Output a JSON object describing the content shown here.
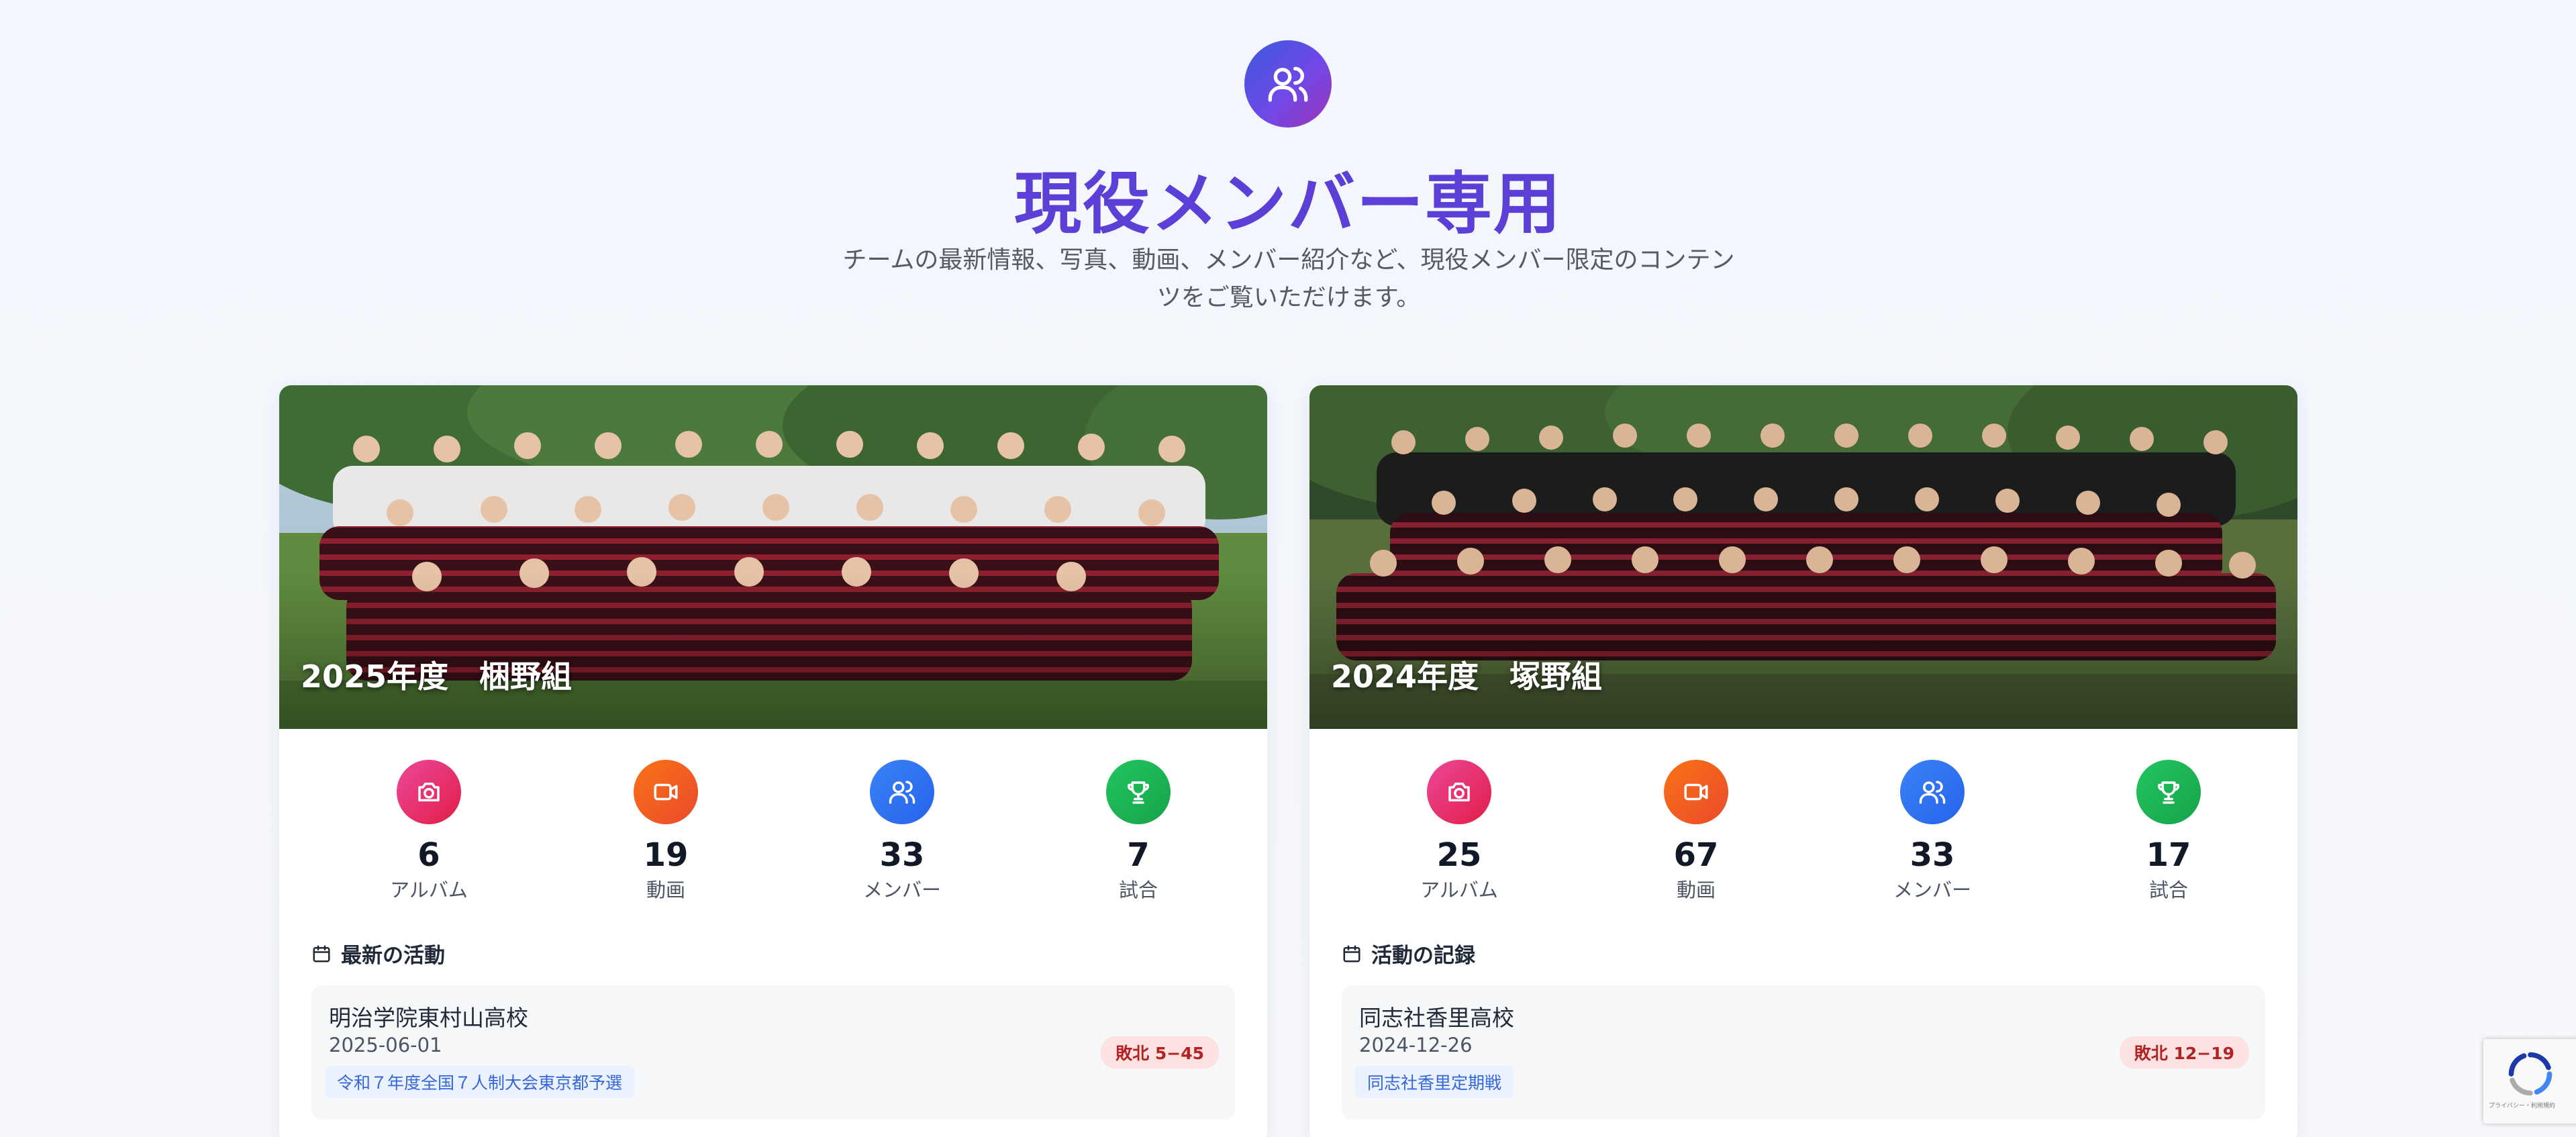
{
  "header": {
    "icon": "users-icon",
    "title": "現役メンバー専用",
    "description": "チームの最新情報、写真、動画、メンバー紹介など、現役メンバー限定のコンテンツをご覧いただけます。"
  },
  "cards": [
    {
      "title": "2025年度　梱野組",
      "stats": [
        {
          "icon": "camera-icon",
          "value": "6",
          "label": "アルバム",
          "color": "#ec4899"
        },
        {
          "icon": "video-icon",
          "value": "19",
          "label": "動画",
          "color": "#f97316"
        },
        {
          "icon": "users-icon",
          "value": "33",
          "label": "メンバー",
          "color": "#3b82f6"
        },
        {
          "icon": "trophy-icon",
          "value": "7",
          "label": "試合",
          "color": "#22c55e"
        }
      ],
      "section_title": "最新の活動",
      "activity": {
        "school": "明治学院東村山高校",
        "date": "2025-06-01",
        "tag": "令和７年度全国７人制大会東京都予選",
        "result": "敗北  5−45"
      }
    },
    {
      "title": "2024年度　塚野組",
      "stats": [
        {
          "icon": "camera-icon",
          "value": "25",
          "label": "アルバム",
          "color": "#ec4899"
        },
        {
          "icon": "video-icon",
          "value": "67",
          "label": "動画",
          "color": "#f97316"
        },
        {
          "icon": "users-icon",
          "value": "33",
          "label": "メンバー",
          "color": "#3b82f6"
        },
        {
          "icon": "trophy-icon",
          "value": "17",
          "label": "試合",
          "color": "#22c55e"
        }
      ],
      "section_title": "活動の記録",
      "activity": {
        "school": "同志社香里高校",
        "date": "2024-12-26",
        "tag": "同志社香里定期戦",
        "result": "敗北  12−19"
      }
    }
  ],
  "recaptcha": {
    "footer": "プライバシー・利用規約"
  }
}
